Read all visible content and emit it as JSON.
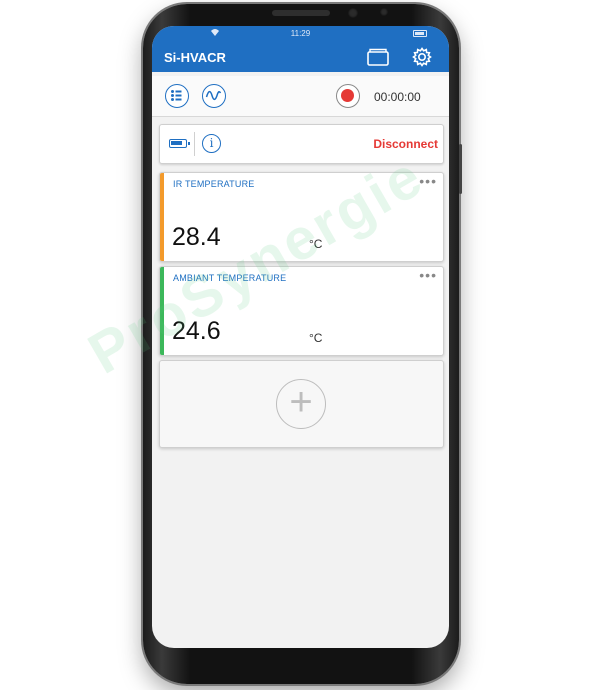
{
  "statusbar": {
    "time": "11:29"
  },
  "appbar": {
    "title": "Si-HVACR"
  },
  "toolbar": {
    "timer": "00:00:00"
  },
  "device": {
    "info_glyph": "i",
    "disconnect_label": "Disconnect"
  },
  "sensors": [
    {
      "label": "IR TEMPERATURE",
      "value": "28.4",
      "unit": "°C",
      "accent": "#f39a2b"
    },
    {
      "label": "AMBIANT TEMPERATURE",
      "value": "24.6",
      "unit": "°C",
      "accent": "#3cb85a"
    }
  ],
  "add_card": {
    "glyph": "+"
  },
  "watermark": {
    "text": "ProSynergie"
  },
  "icons": {
    "appbar": [
      "folder-icon",
      "gear-icon"
    ],
    "toolbar": [
      "list-icon",
      "waveform-icon",
      "record-icon"
    ],
    "device": [
      "battery-icon",
      "info-icon"
    ]
  },
  "colors": {
    "primary": "#1f6fc2",
    "record": "#e53935",
    "disconnect": "#e53935"
  }
}
